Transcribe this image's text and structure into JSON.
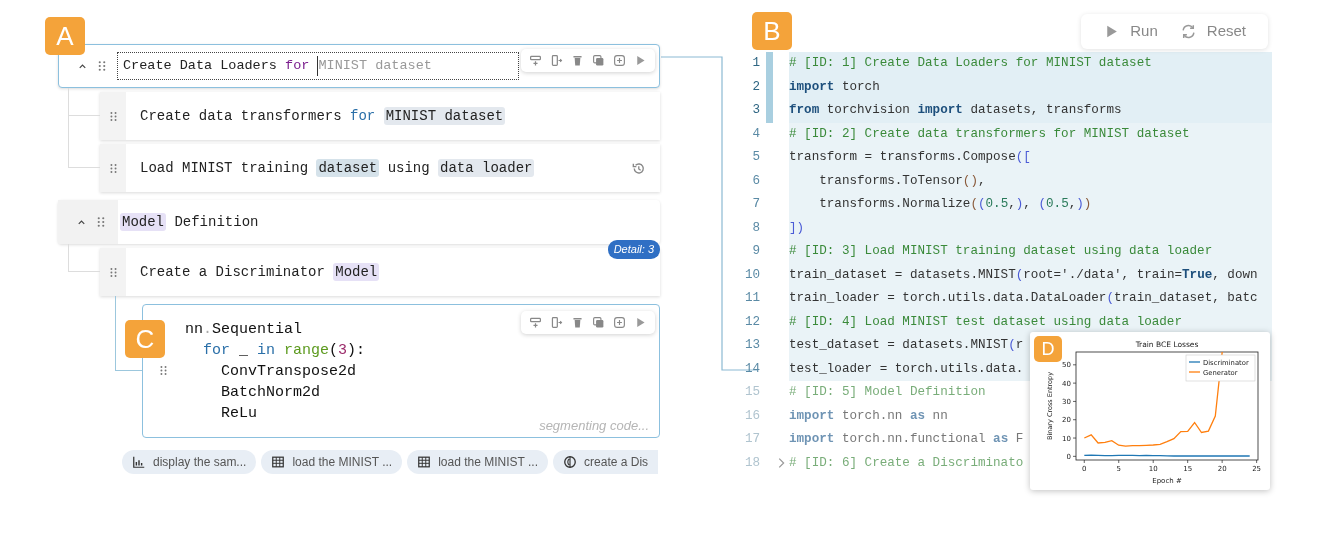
{
  "callouts": [
    "A",
    "B",
    "C",
    "D"
  ],
  "outline": [
    {
      "kind": "section",
      "expanded": true,
      "editing": true,
      "segments": [
        {
          "kind": "text",
          "text": "Create Data Loaders "
        },
        {
          "kind": "keyword",
          "text": "for "
        },
        {
          "kind": "suggestion",
          "text": "MINIST dataset"
        }
      ],
      "children": [
        {
          "kind": "step",
          "history": false,
          "segments": [
            {
              "kind": "text",
              "text": "Create data transformers "
            },
            {
              "kind": "keyword",
              "text": "for "
            },
            {
              "kind": "highlight",
              "text": "MINIST dataset",
              "color": "#e3e8ee"
            }
          ]
        },
        {
          "kind": "step",
          "history": true,
          "segments": [
            {
              "kind": "text",
              "text": "Load MINIST training "
            },
            {
              "kind": "highlight",
              "text": "dataset",
              "color": "#d5e2ea"
            },
            {
              "kind": "text",
              "text": " using "
            },
            {
              "kind": "highlight",
              "text": "data loader",
              "color": "#e3e8ee"
            }
          ]
        }
      ]
    },
    {
      "kind": "section",
      "expanded": true,
      "editing": false,
      "segments": [
        {
          "kind": "highlight",
          "text": "Model",
          "color": "#e6e1f6"
        },
        {
          "kind": "text",
          "text": " Definition"
        }
      ],
      "children": [
        {
          "kind": "step",
          "history": false,
          "badge": "Detail: 3",
          "segments": [
            {
              "kind": "text",
              "text": "Create a Discriminator "
            },
            {
              "kind": "highlight",
              "text": "Model",
              "color": "#e6e1f6"
            }
          ],
          "children": [
            {
              "kind": "code",
              "status": "segmenting code...",
              "lines": [
                [
                  {
                    "kind": "text",
                    "text": "nn"
                  },
                  {
                    "kind": "punct",
                    "text": "."
                  },
                  {
                    "kind": "text",
                    "text": "Sequential"
                  }
                ],
                [
                  {
                    "kind": "keyword",
                    "text": "  for"
                  },
                  {
                    "kind": "text",
                    "text": " _ "
                  },
                  {
                    "kind": "keyword",
                    "text": "in "
                  },
                  {
                    "kind": "function",
                    "text": "range"
                  },
                  {
                    "kind": "text",
                    "text": "("
                  },
                  {
                    "kind": "number",
                    "text": "3"
                  },
                  {
                    "kind": "text",
                    "text": "):"
                  }
                ],
                [
                  {
                    "kind": "text",
                    "text": "    ConvTranspose2d"
                  }
                ],
                [
                  {
                    "kind": "text",
                    "text": "    BatchNorm2d"
                  }
                ],
                [
                  {
                    "kind": "text",
                    "text": "    ReLu"
                  }
                ]
              ]
            }
          ]
        }
      ]
    }
  ],
  "chips": [
    {
      "kind": "chart",
      "label": "display the sam..."
    },
    {
      "kind": "table",
      "label": "load the MINIST ..."
    },
    {
      "kind": "table",
      "label": "load the MINIST ..."
    },
    {
      "kind": "model",
      "label": "create a Dis"
    }
  ],
  "editor_toolbar": [
    {
      "label": "Run"
    },
    {
      "label": "Reset"
    }
  ],
  "editor_lines": [
    {
      "number": "1",
      "selected": true,
      "linked": true,
      "folded": false,
      "tokens": [
        {
          "kind": "comment",
          "text": "# [ID: 1] Create Data Loaders for MINIST dataset"
        }
      ]
    },
    {
      "number": "2",
      "selected": true,
      "linked": true,
      "folded": false,
      "tokens": [
        {
          "kind": "keyword",
          "text": "import"
        },
        {
          "kind": "plain",
          "text": " torch"
        }
      ]
    },
    {
      "number": "3",
      "selected": true,
      "linked": true,
      "folded": false,
      "tokens": [
        {
          "kind": "keyword",
          "text": "from"
        },
        {
          "kind": "plain",
          "text": " torchvision "
        },
        {
          "kind": "keyword",
          "text": "import"
        },
        {
          "kind": "plain",
          "text": " datasets, transforms"
        }
      ]
    },
    {
      "number": "4",
      "selected": false,
      "linked": true,
      "folded": false,
      "tokens": [
        {
          "kind": "comment",
          "text": "# [ID: 2] Create data transformers for MINIST dataset"
        }
      ]
    },
    {
      "number": "5",
      "selected": false,
      "linked": true,
      "folded": false,
      "tokens": [
        {
          "kind": "plain",
          "text": "transform = transforms.Compose"
        },
        {
          "kind": "bracket",
          "text": "(["
        }
      ]
    },
    {
      "number": "6",
      "selected": false,
      "linked": true,
      "folded": false,
      "tokens": [
        {
          "kind": "plain",
          "text": "    transforms.ToTensor"
        },
        {
          "kind": "paren",
          "text": "()"
        },
        {
          "kind": "plain",
          "text": ","
        }
      ]
    },
    {
      "number": "7",
      "selected": false,
      "linked": true,
      "folded": false,
      "tokens": [
        {
          "kind": "plain",
          "text": "    transforms.Normalize"
        },
        {
          "kind": "paren",
          "text": "("
        },
        {
          "kind": "bracket",
          "text": "("
        },
        {
          "kind": "number",
          "text": "0.5"
        },
        {
          "kind": "plain",
          "text": ","
        },
        {
          "kind": "bracket",
          "text": ")"
        },
        {
          "kind": "plain",
          "text": ", "
        },
        {
          "kind": "bracket",
          "text": "("
        },
        {
          "kind": "number",
          "text": "0.5"
        },
        {
          "kind": "plain",
          "text": ","
        },
        {
          "kind": "bracket",
          "text": ")"
        },
        {
          "kind": "paren",
          "text": ")"
        }
      ]
    },
    {
      "number": "8",
      "selected": false,
      "linked": true,
      "folded": false,
      "tokens": [
        {
          "kind": "bracket",
          "text": "])"
        }
      ]
    },
    {
      "number": "9",
      "selected": false,
      "linked": true,
      "folded": false,
      "tokens": [
        {
          "kind": "comment",
          "text": "# [ID: 3] Load MINIST training dataset using data loader"
        }
      ]
    },
    {
      "number": "10",
      "selected": false,
      "linked": true,
      "folded": false,
      "tokens": [
        {
          "kind": "plain",
          "text": "train_dataset = datasets.MNIST"
        },
        {
          "kind": "bracket",
          "text": "("
        },
        {
          "kind": "plain",
          "text": "root='./data', train="
        },
        {
          "kind": "bool",
          "text": "True"
        },
        {
          "kind": "plain",
          "text": ", down"
        }
      ]
    },
    {
      "number": "11",
      "selected": false,
      "linked": true,
      "folded": false,
      "tokens": [
        {
          "kind": "plain",
          "text": "train_loader = torch.utils.data.DataLoader"
        },
        {
          "kind": "bracket",
          "text": "("
        },
        {
          "kind": "plain",
          "text": "train_dataset, batc"
        }
      ]
    },
    {
      "number": "12",
      "selected": false,
      "linked": true,
      "folded": false,
      "tokens": [
        {
          "kind": "comment",
          "text": "# [ID: 4] Load MINIST test dataset using data loader"
        }
      ]
    },
    {
      "number": "13",
      "selected": false,
      "linked": true,
      "folded": false,
      "tokens": [
        {
          "kind": "plain",
          "text": "test_dataset = datasets.MNIST"
        },
        {
          "kind": "bracket",
          "text": "("
        },
        {
          "kind": "plain",
          "text": "r"
        }
      ]
    },
    {
      "number": "14",
      "selected": false,
      "linked": true,
      "folded": false,
      "tokens": [
        {
          "kind": "plain",
          "text": "test_loader = torch.utils.data."
        }
      ]
    },
    {
      "number": "15",
      "selected": false,
      "linked": false,
      "folded": false,
      "tokens": [
        {
          "kind": "comment",
          "text": "# [ID: 5] Model Definition"
        }
      ]
    },
    {
      "number": "16",
      "selected": false,
      "linked": false,
      "folded": false,
      "tokens": [
        {
          "kind": "keyword",
          "text": "import"
        },
        {
          "kind": "plain",
          "text": " torch.nn "
        },
        {
          "kind": "keyword",
          "text": "as"
        },
        {
          "kind": "plain",
          "text": " nn"
        }
      ]
    },
    {
      "number": "17",
      "selected": false,
      "linked": false,
      "folded": false,
      "tokens": [
        {
          "kind": "keyword",
          "text": "import"
        },
        {
          "kind": "plain",
          "text": " torch.nn.functional "
        },
        {
          "kind": "keyword",
          "text": "as"
        },
        {
          "kind": "plain",
          "text": " F"
        }
      ]
    },
    {
      "number": "18",
      "selected": false,
      "linked": false,
      "folded": true,
      "tokens": [
        {
          "kind": "comment",
          "text": "# [ID: 6] Create a Discriminato"
        }
      ]
    }
  ],
  "plot": {
    "chart_data": {
      "type": "line",
      "title": "Train BCE Losses",
      "xlabel": "Epoch #",
      "ylabel": "Binary Cross Entropy",
      "x": [
        0,
        1,
        2,
        3,
        4,
        5,
        6,
        7,
        8,
        9,
        10,
        11,
        12,
        13,
        14,
        15,
        16,
        17,
        18,
        19,
        20,
        21,
        22,
        23,
        24
      ],
      "series": [
        {
          "name": "Discriminator",
          "color": "#1f77b4",
          "values": [
            0.5,
            0.6,
            0.5,
            0.4,
            0.4,
            0.5,
            0.5,
            0.5,
            0.4,
            0.5,
            0.4,
            0.4,
            0.3,
            0.2,
            0.2,
            0.2,
            0.2,
            0.2,
            0.2,
            0.2,
            0.2,
            0.2,
            0.2,
            0.2,
            0.2
          ]
        },
        {
          "name": "Generator",
          "color": "#ff7f0e",
          "values": [
            10,
            11.7,
            7.3,
            7.6,
            8.6,
            6.1,
            5.6,
            5.8,
            5.8,
            6.0,
            6.2,
            6.5,
            8.0,
            9.7,
            13.5,
            13.6,
            18.5,
            13.0,
            13.8,
            22,
            57,
            null,
            null,
            null,
            null
          ]
        }
      ],
      "xlim": [
        -1.2,
        25.2
      ],
      "ylim": [
        -2,
        57
      ],
      "xticks": [
        0,
        5,
        10,
        15,
        20,
        25
      ],
      "yticks": [
        0,
        10,
        20,
        30,
        40,
        50
      ],
      "legend": true
    }
  }
}
